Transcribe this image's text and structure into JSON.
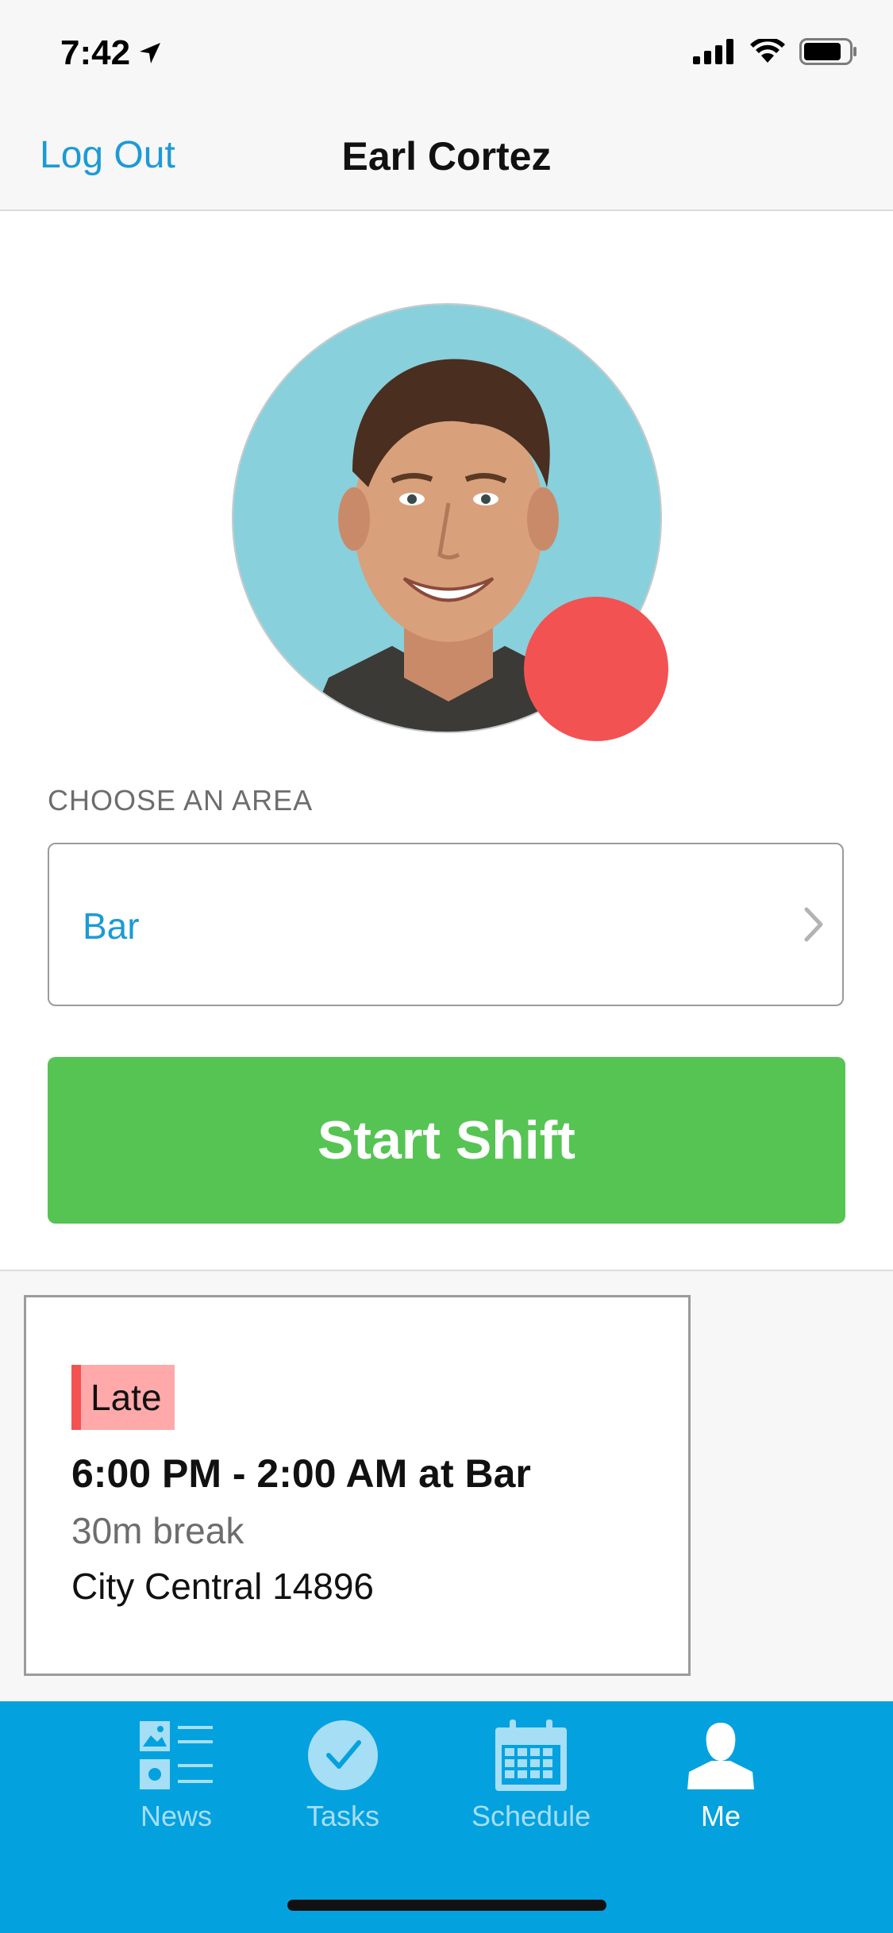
{
  "status_bar": {
    "time": "7:42"
  },
  "header": {
    "left_action": "Log Out",
    "title": "Earl Cortez"
  },
  "profile": {
    "status_color": "#f35253"
  },
  "area": {
    "label": "CHOOSE AN AREA",
    "selected": "Bar"
  },
  "start_button": {
    "label": "Start Shift",
    "color": "#55c453"
  },
  "shift_card": {
    "badge": "Late",
    "time": "6:00 PM - 2:00 AM at Bar",
    "break": "30m break",
    "location": "City Central 14896"
  },
  "tabs": [
    {
      "label": "News",
      "icon": "news-icon",
      "active": false
    },
    {
      "label": "Tasks",
      "icon": "check-circle-icon",
      "active": false
    },
    {
      "label": "Schedule",
      "icon": "calendar-icon",
      "active": false
    },
    {
      "label": "Me",
      "icon": "person-icon",
      "active": true
    }
  ],
  "colors": {
    "accent": "#1c9ad6",
    "tab_bar": "#04a1df"
  }
}
